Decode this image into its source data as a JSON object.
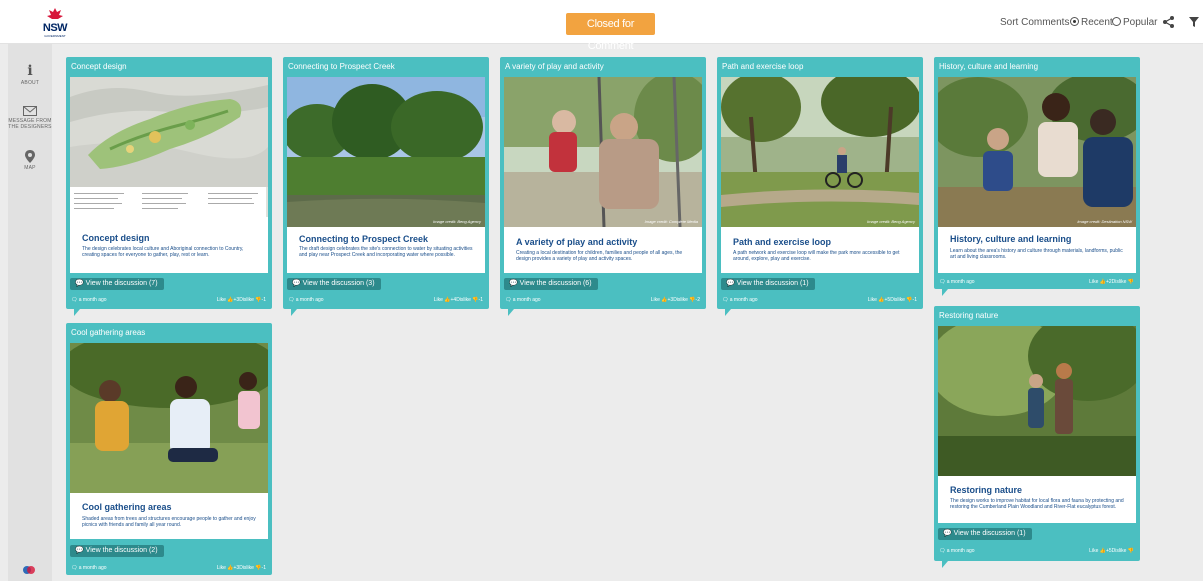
{
  "header": {
    "logo_text": "NSW",
    "logo_subtext": "GOVERNMENT",
    "status_label": "Closed for Comment",
    "sort_label": "Sort Comments",
    "sort_options": [
      {
        "label": "Recent",
        "selected": true
      },
      {
        "label": "Popular",
        "selected": false
      }
    ]
  },
  "sidebar": {
    "items": [
      {
        "label": "ABOUT",
        "icon": "info-icon"
      },
      {
        "label": "MESSAGE FROM THE DESIGNERS",
        "icon": "envelope-icon"
      },
      {
        "label": "MAP",
        "icon": "map-pin-icon"
      }
    ]
  },
  "colors": {
    "card_teal": "#4bbfc1",
    "button_dark_teal": "#2d8a8c",
    "status_orange": "#f2a340",
    "heading_blue": "#1a4e8a"
  },
  "cards": [
    {
      "header": "Concept design",
      "title": "Concept design",
      "description": "The design celebrates local culture and Aboriginal connection to Country, creating spaces for everyone to gather, play, rest or learn.",
      "credit": "",
      "discussion": "View the discussion (7)",
      "time": "a month ago",
      "likes": "Like 👍+3Dislike 👎-1"
    },
    {
      "header": "Connecting to Prospect Creek",
      "title": "Connecting to Prospect Creek",
      "description": "The draft design celebrates the site's connection to water by situating activities and play near Prospect Creek and incorporating water where possible.",
      "credit": "Image credit: Beng Agency",
      "discussion": "View the discussion (3)",
      "time": "a month ago",
      "likes": "Like 👍+4Dislike 👎-1"
    },
    {
      "header": "A variety of play and activity",
      "title": "A variety of play and activity",
      "description": "Creating a local destination for children, families and people of all ages, the design provides a variety of play and activity spaces.",
      "credit": "Image credit: Complete Media",
      "discussion": "View the discussion (6)",
      "time": "a month ago",
      "likes": "Like 👍+3Dislike 👎-2"
    },
    {
      "header": "Path and exercise loop",
      "title": "Path and exercise loop",
      "description": "A path network and exercise loop will make the park more accessible to get around, explore, play and exercise.",
      "credit": "Image credit: Beng Agency",
      "discussion": "View the discussion (1)",
      "time": "a month ago",
      "likes": "Like 👍+5Dislike 👎-1"
    },
    {
      "header": "History, culture and learning",
      "title": "History, culture and learning",
      "description": "Learn about the area's history and culture through materials, landforms, public art and living classrooms.",
      "credit": "Image credit: Destination NSW",
      "discussion": "",
      "time": "a month ago",
      "likes": "Like 👍+2Dislike 👎"
    },
    {
      "header": "Cool gathering areas",
      "title": "Cool gathering areas",
      "description": "Shaded areas from trees and structures encourage people to gather and enjoy picnics with friends and family all year round.",
      "credit": "",
      "discussion": "View the discussion (2)",
      "time": "a month ago",
      "likes": "Like 👍+3Dislike 👎-1"
    },
    {
      "header": "Restoring nature",
      "title": "Restoring nature",
      "description": "The design works to improve habitat for local flora and fauna by protecting and restoring the Cumberland Plain Woodland and River-Flat eucalyptus forest.",
      "credit": "",
      "discussion": "View the discussion (1)",
      "time": "a month ago",
      "likes": "Like 👍+5Dislike 👎"
    }
  ]
}
